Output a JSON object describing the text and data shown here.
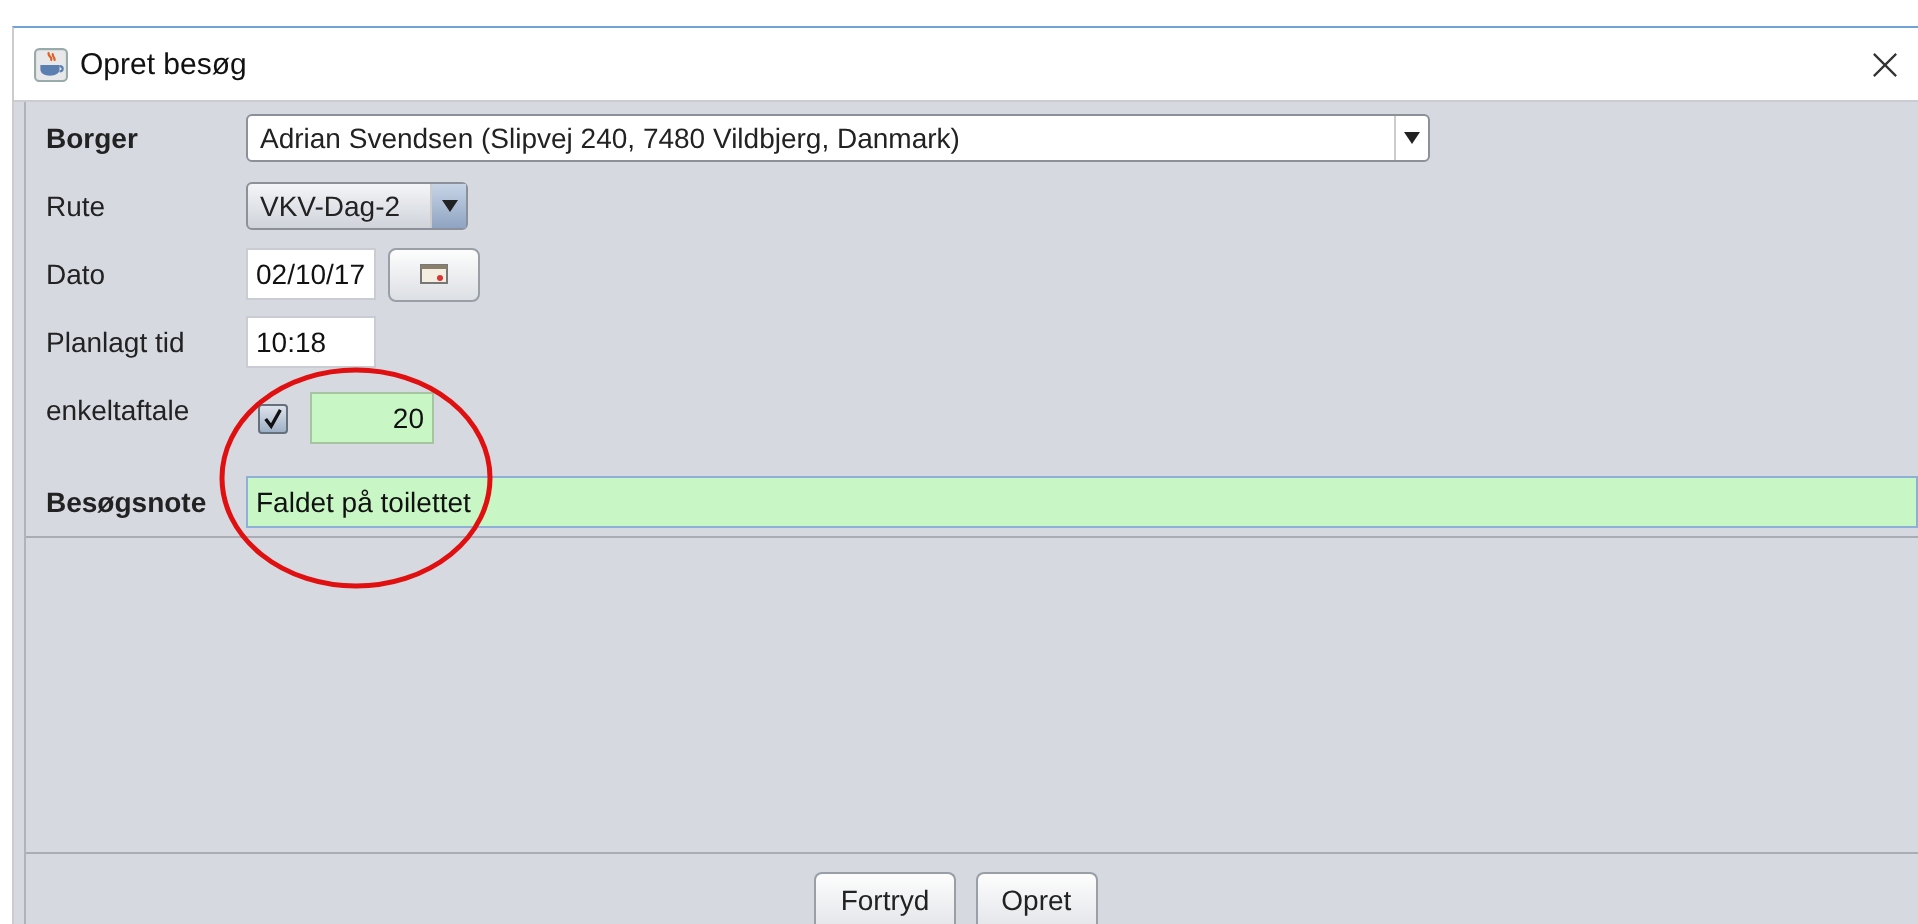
{
  "window": {
    "title": "Opret besøg"
  },
  "fields": [
    {
      "kind": "combo",
      "label": "Borger",
      "label_bold": true,
      "value": "Adrian Svendsen (Slipvej 240, 7480 Vildbjerg, Danmark)"
    },
    {
      "kind": "combo",
      "label": "Rute",
      "label_bold": false,
      "value": "VKV-Dag-2"
    },
    {
      "kind": "date",
      "label": "Dato",
      "label_bold": false,
      "value": "02/10/17",
      "highlighted": false
    },
    {
      "kind": "text",
      "label": "Planlagt tid",
      "label_bold": false,
      "value": "10:18",
      "highlighted": false
    },
    {
      "kind": "check",
      "label": "enkeltaftale",
      "label_bold": false,
      "checked": true,
      "value": "20",
      "highlighted": true
    },
    {
      "kind": "text",
      "label": "Besøgsnote",
      "label_bold": true,
      "value": "Faldet på toilettet",
      "highlighted": true
    }
  ],
  "buttons": [
    "Fortryd",
    "Opret"
  ]
}
